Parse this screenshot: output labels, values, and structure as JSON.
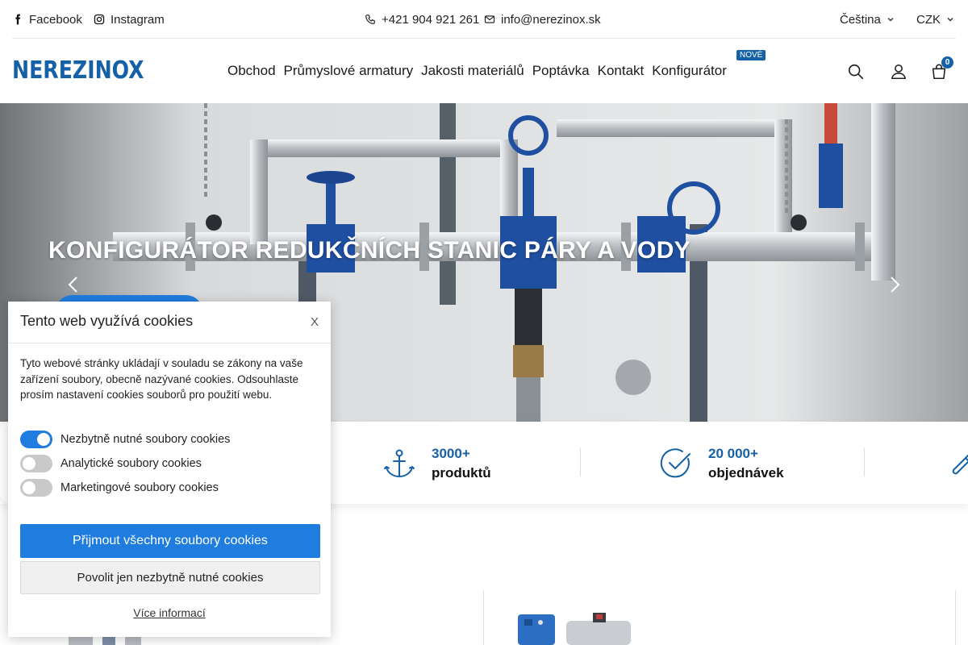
{
  "topbar": {
    "facebook": "Facebook",
    "instagram": "Instagram",
    "phone": "+421 904 921 261",
    "email": "info@nerezinox.sk",
    "language": "Čeština",
    "currency": "CZK"
  },
  "header": {
    "logo": "NEREZINOX",
    "nav": [
      {
        "label": "Obchod"
      },
      {
        "label": "Průmyslové armatury"
      },
      {
        "label": "Jakosti materiálů"
      },
      {
        "label": "Poptávka"
      },
      {
        "label": "Kontakt"
      },
      {
        "label": "Konfigurátor"
      }
    ],
    "new_badge": "NOVÉ",
    "cart_count": "0",
    "icons": [
      "search-icon",
      "user-icon",
      "cart-icon"
    ]
  },
  "hero": {
    "title": "KONFIGURÁTOR REDUKČNÍCH STANIC PÁRY A VODY"
  },
  "stats": [
    {
      "number": "3000+",
      "label": "produktů",
      "icon": "anchor-icon"
    },
    {
      "number": "20 000+",
      "label": "objednávek",
      "icon": "check-circle-icon"
    }
  ],
  "cookie": {
    "title": "Tento web využívá cookies",
    "close": "X",
    "text": "Tyto webové stránky ukládají v souladu se zákony na vaše zařízení soubory, obecně nazývané cookies. Odsouhlaste prosím nastavení cookies souborů pro použití webu.",
    "options": [
      {
        "label": "Nezbytně nutné soubory cookies",
        "enabled": true
      },
      {
        "label": "Analytické soubory cookies",
        "enabled": false
      },
      {
        "label": "Marketingové soubory cookies",
        "enabled": false
      }
    ],
    "accept_all": "Přijmout všechny soubory cookies",
    "only_necessary": "Povolit jen nezbytně nutné cookies",
    "more_info": "Více informací"
  },
  "colors": {
    "brand": "#1561a8",
    "accent": "#1f7de0"
  }
}
